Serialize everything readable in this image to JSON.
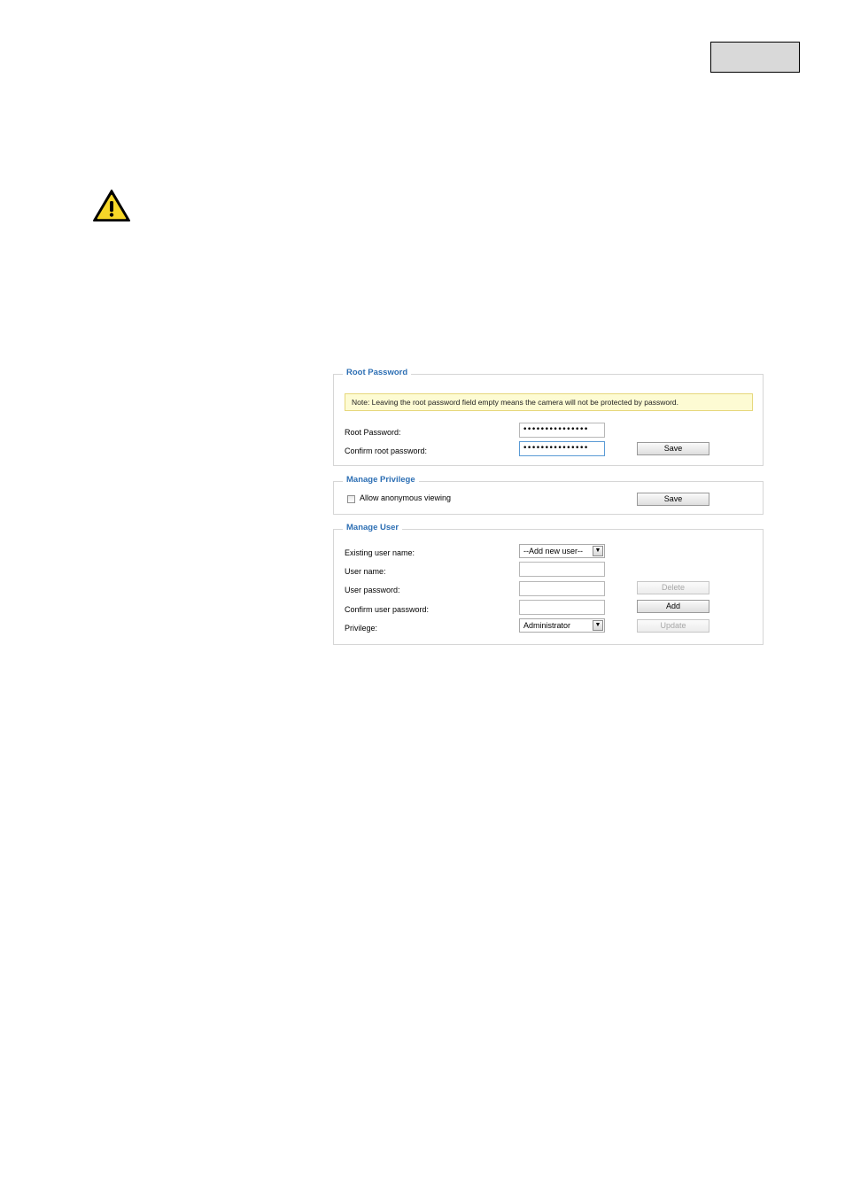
{
  "root_password": {
    "legend": "Root Password",
    "note": "Note: Leaving the root password field empty means the camera will not be protected by password.",
    "root_password_label": "Root Password:",
    "root_password_value": "•••••••••••••••",
    "confirm_label": "Confirm root password:",
    "confirm_value": "•••••••••••••••",
    "save_label": "Save"
  },
  "manage_privilege": {
    "legend": "Manage Privilege",
    "allow_anonymous_label": "Allow anonymous viewing",
    "allow_anonymous_checked": false,
    "save_label": "Save"
  },
  "manage_user": {
    "legend": "Manage User",
    "existing_user_label": "Existing user name:",
    "existing_user_value": "--Add new user--",
    "user_name_label": "User name:",
    "user_password_label": "User password:",
    "confirm_password_label": "Confirm user password:",
    "privilege_label": "Privilege:",
    "privilege_value": "Administrator",
    "delete_label": "Delete",
    "add_label": "Add",
    "update_label": "Update"
  },
  "icons": {
    "warning": "warning-icon",
    "dropdown": "chevron-down-icon"
  },
  "colors": {
    "legend": "#2d6fb4",
    "note_bg": "#fdfbd3",
    "page_box": "#d9d9d9"
  }
}
